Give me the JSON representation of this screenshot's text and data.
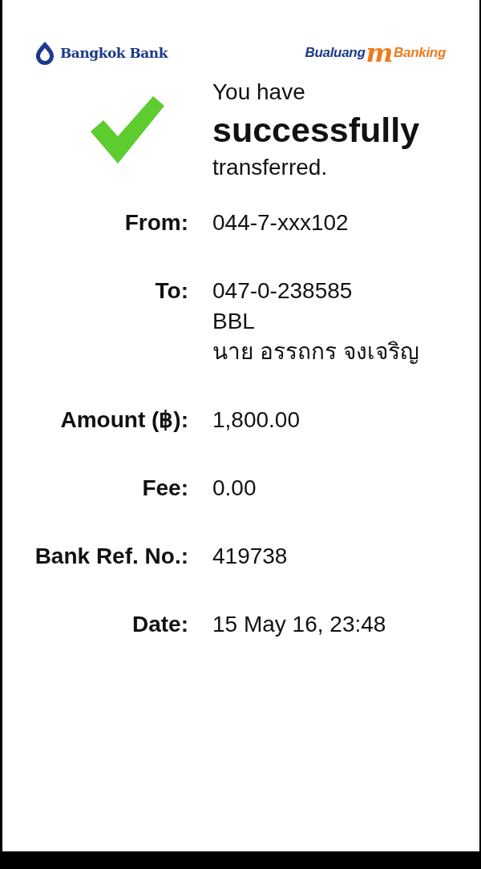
{
  "header": {
    "bank_logo": "Bangkok Bank",
    "app_logo": {
      "prefix": "Bualuang",
      "mark": "m",
      "suffix": "Banking"
    }
  },
  "message": {
    "lines": [
      {
        "text": "You have",
        "kind": "normal"
      },
      {
        "text": "successfully",
        "kind": "strong"
      },
      {
        "text": "transferred.",
        "kind": "normal"
      }
    ]
  },
  "details": [
    {
      "label": "From:",
      "values": [
        "044-7-xxx102"
      ]
    },
    {
      "label": "To:",
      "values": [
        "047-0-238585",
        "BBL",
        "นาย อรรถกร จงเจริญ"
      ]
    },
    {
      "label": "Amount (฿):",
      "values": [
        "1,800.00"
      ]
    },
    {
      "label": "Fee:",
      "values": [
        "0.00"
      ]
    },
    {
      "label": "Bank Ref. No.:",
      "values": [
        "419738"
      ]
    },
    {
      "label": "Date:",
      "values": [
        "15 May 16, 23:48"
      ]
    }
  ]
}
